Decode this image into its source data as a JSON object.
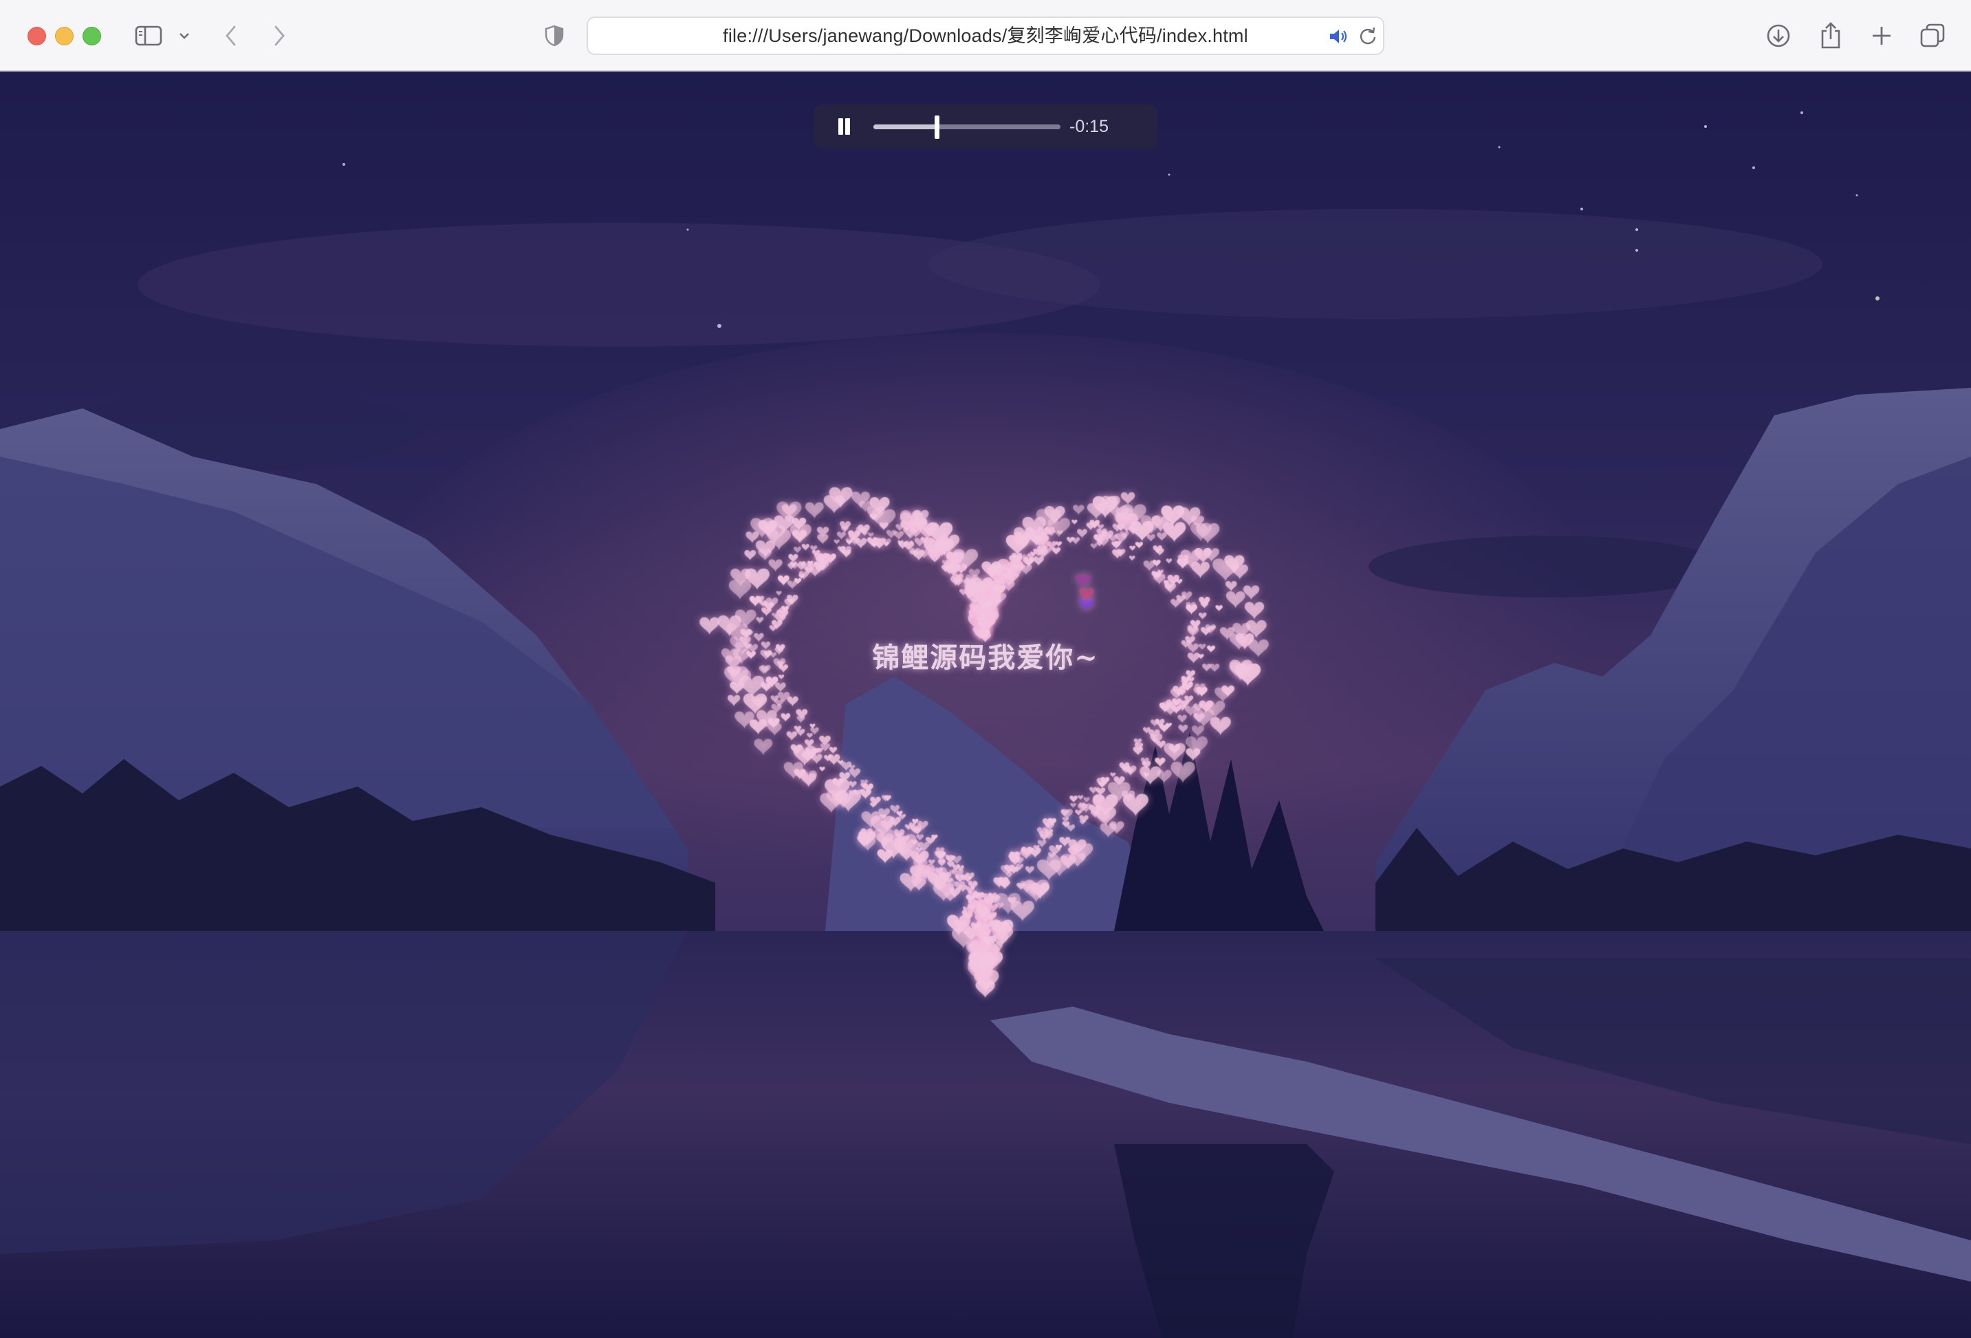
{
  "browser": {
    "url": "file:///Users/janewang/Downloads/复刻李峋爱心代码/index.html",
    "icons": [
      "close-icon",
      "minimize-icon",
      "zoom-icon",
      "sidebar-icon",
      "chevron-down-icon",
      "back-icon",
      "forward-icon",
      "shield-icon",
      "speaker-icon",
      "reload-icon",
      "download-icon",
      "share-icon",
      "plus-icon",
      "tabs-icon"
    ]
  },
  "player": {
    "state": "playing",
    "time_remaining": "-0:15",
    "progress": 0.34
  },
  "page": {
    "message": "锦鲤源码我爱你~"
  },
  "colors": {
    "heart": "#f2c6df",
    "sky_top": "#1e1c4c",
    "sky_mid": "#3d2d5f",
    "mountain": "#2f2d62",
    "water": "#1d1b45"
  }
}
